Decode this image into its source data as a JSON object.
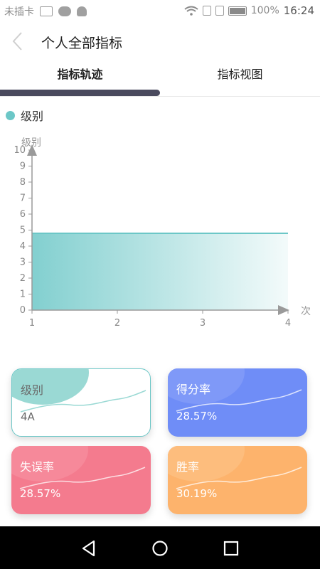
{
  "status_bar": {
    "carrier": "未插卡",
    "battery": "100%",
    "time": "16:24"
  },
  "header": {
    "title": "个人全部指标"
  },
  "tabs": [
    {
      "label": "指标轨迹",
      "active": true
    },
    {
      "label": "指标视图",
      "active": false
    }
  ],
  "legend": {
    "label": "级别",
    "color": "#6cc7c7"
  },
  "chart_data": {
    "type": "area",
    "x": [
      1,
      2,
      3,
      4
    ],
    "series": [
      {
        "name": "级别",
        "values": [
          4.8,
          4.8,
          4.8,
          4.8
        ]
      }
    ],
    "xlabel": "次",
    "ylabel": "级别",
    "xlim": [
      1,
      4
    ],
    "ylim": [
      0,
      10
    ],
    "yticks": [
      0,
      1,
      2,
      3,
      4,
      5,
      6,
      7,
      8,
      9,
      10
    ],
    "xticks": [
      1,
      2,
      3,
      4
    ],
    "color": "#6cc7c7",
    "grid": false
  },
  "cards": [
    {
      "label": "级别",
      "value": "4A",
      "color": "#6cc7c7"
    },
    {
      "label": "得分率",
      "value": "28.57%",
      "color": "#6f8df7"
    },
    {
      "label": "失误率",
      "value": "28.57%",
      "color": "#f47b8e"
    },
    {
      "label": "胜率",
      "value": "30.19%",
      "color": "#fdb36c"
    }
  ]
}
